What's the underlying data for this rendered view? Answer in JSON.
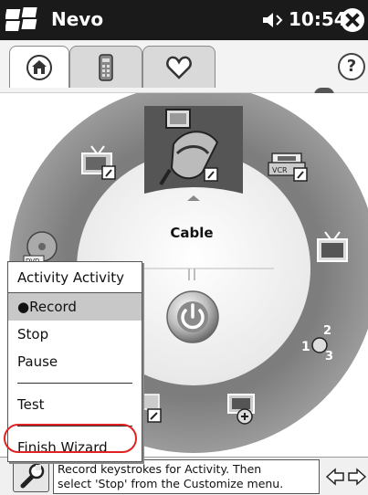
{
  "titlebar": {
    "app_title": "Nevo",
    "time": "10:54",
    "icons": [
      "windows-logo-icon",
      "speaker-icon",
      "close-icon"
    ]
  },
  "tabs": [
    {
      "name": "home",
      "icon": "home-icon",
      "active": true
    },
    {
      "name": "remote",
      "icon": "remote-icon",
      "active": false
    },
    {
      "name": "favorites",
      "icon": "heart-icon",
      "active": false
    }
  ],
  "help": {
    "label": "?"
  },
  "wheel": {
    "selected_device": "Cable",
    "devices": [
      {
        "name": "cable",
        "icon": "cable-icon"
      },
      {
        "name": "tv-config",
        "icon": "tv-wrench-icon"
      },
      {
        "name": "vcr",
        "icon": "vcr-icon"
      },
      {
        "name": "dvd",
        "icon": "dvd-icon"
      },
      {
        "name": "tv",
        "icon": "tv-icon"
      },
      {
        "name": "activity",
        "icon": "activity-numbers-icon"
      },
      {
        "name": "add-device",
        "icon": "add-device-icon"
      }
    ],
    "power_icon": "power-icon"
  },
  "menu": {
    "header": "Activity Activity",
    "items": [
      {
        "label": "Record",
        "bullet": "●",
        "selected": true
      },
      {
        "label": "Stop",
        "selected": false
      },
      {
        "label": "Pause",
        "selected": false
      },
      {
        "label": "Test",
        "selected": false
      },
      {
        "label": "Finish Wizard",
        "selected": false
      }
    ]
  },
  "status": {
    "line1": "Record keystrokes for Activity. Then",
    "line2": "select 'Stop' from the Customize menu."
  },
  "colors": {
    "ring": "#8c8c8c",
    "highlight": "#e02222",
    "titlebar": "#1a1a1a"
  }
}
